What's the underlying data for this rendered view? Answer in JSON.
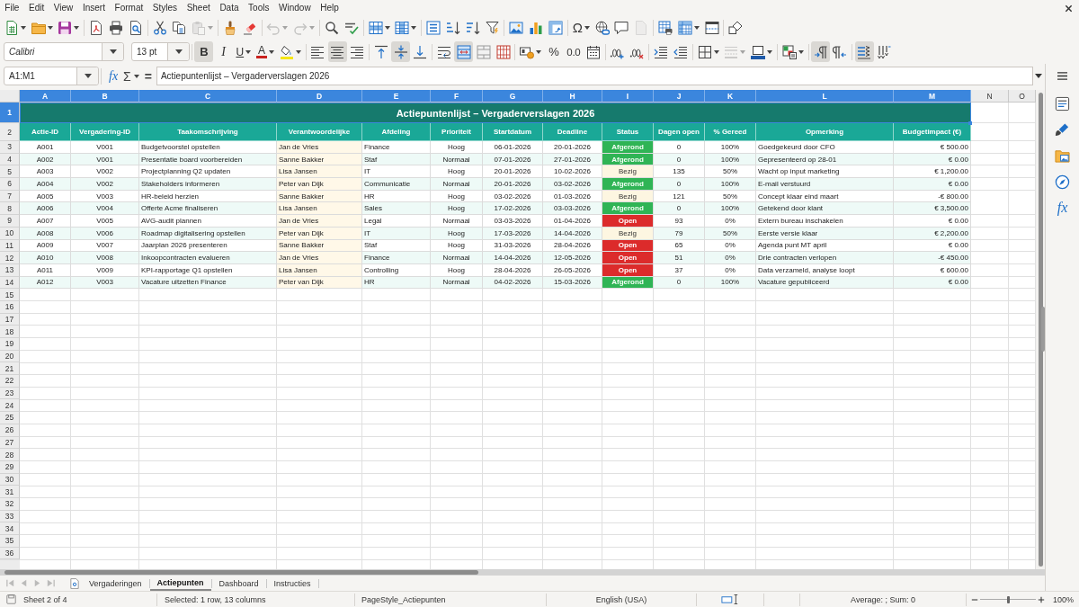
{
  "menu_bar": {
    "items": [
      "File",
      "Edit",
      "View",
      "Insert",
      "Format",
      "Styles",
      "Sheet",
      "Data",
      "Tools",
      "Window",
      "Help"
    ]
  },
  "toolbar_standard": {
    "groups": [
      [
        {
          "kind": "new",
          "dropdown": true,
          "disabled": false
        },
        {
          "kind": "open",
          "dropdown": true,
          "disabled": false
        },
        {
          "kind": "save",
          "dropdown": true,
          "disabled": false
        }
      ],
      [
        {
          "kind": "export_pdf",
          "dropdown": false,
          "disabled": false
        },
        {
          "kind": "print",
          "dropdown": false,
          "disabled": false
        },
        {
          "kind": "print_preview",
          "dropdown": false,
          "disabled": false
        }
      ],
      [
        {
          "kind": "cut",
          "dropdown": false,
          "disabled": false
        },
        {
          "kind": "copy",
          "dropdown": false,
          "disabled": false
        },
        {
          "kind": "paste",
          "dropdown": true,
          "disabled": true
        }
      ],
      [
        {
          "kind": "clone",
          "dropdown": false,
          "disabled": false
        },
        {
          "kind": "clear_format",
          "dropdown": false,
          "disabled": false
        }
      ],
      [
        {
          "kind": "undo",
          "dropdown": true,
          "disabled": true
        },
        {
          "kind": "redo",
          "dropdown": true,
          "disabled": true
        }
      ],
      [
        {
          "kind": "find",
          "dropdown": false,
          "disabled": false
        },
        {
          "kind": "spelling",
          "dropdown": false,
          "disabled": false
        }
      ],
      [
        {
          "kind": "row",
          "dropdown": true,
          "disabled": false
        },
        {
          "kind": "column",
          "dropdown": true,
          "disabled": false
        }
      ],
      [
        {
          "kind": "sort",
          "dropdown": false,
          "disabled": false
        },
        {
          "kind": "sort_asc",
          "dropdown": false,
          "disabled": false
        },
        {
          "kind": "sort_desc",
          "dropdown": false,
          "disabled": false
        },
        {
          "kind": "autofilter",
          "dropdown": false,
          "disabled": false
        }
      ],
      [
        {
          "kind": "image",
          "dropdown": false,
          "disabled": false
        },
        {
          "kind": "chart",
          "dropdown": false,
          "disabled": false
        },
        {
          "kind": "pivot",
          "dropdown": false,
          "disabled": false
        }
      ],
      [
        {
          "kind": "special_char",
          "label": "Ω",
          "dropdown": true,
          "disabled": false
        },
        {
          "kind": "hyperlink",
          "dropdown": false,
          "disabled": false
        },
        {
          "kind": "comment",
          "dropdown": false,
          "disabled": false
        },
        {
          "kind": "header_footer",
          "dropdown": false,
          "disabled": true
        }
      ],
      [
        {
          "kind": "print_area",
          "dropdown": false,
          "disabled": false
        },
        {
          "kind": "freeze",
          "dropdown": true,
          "disabled": false
        },
        {
          "kind": "split",
          "dropdown": false,
          "disabled": false
        }
      ],
      [
        {
          "kind": "shapes",
          "dropdown": false,
          "disabled": false
        }
      ]
    ]
  },
  "toolbar_formatting": {
    "font_name": "Calibri",
    "font_size": "13 pt",
    "groups": [
      [
        {
          "kind": "bold",
          "label": "B",
          "dropdown": false,
          "disabled": false,
          "on": true
        },
        {
          "kind": "italic",
          "label": "I",
          "dropdown": false,
          "disabled": false,
          "on": false
        },
        {
          "kind": "underline",
          "label": "U",
          "dropdown": true,
          "disabled": false,
          "on": false
        },
        {
          "kind": "font_color",
          "label": "A",
          "dropdown": true,
          "disabled": false,
          "on": false
        },
        {
          "kind": "highlight",
          "dropdown": true,
          "disabled": false,
          "on": false
        }
      ],
      [
        {
          "kind": "align_left",
          "dropdown": false,
          "disabled": false,
          "on": false
        },
        {
          "kind": "align_center",
          "dropdown": false,
          "disabled": false,
          "on": true
        },
        {
          "kind": "align_right",
          "dropdown": false,
          "disabled": false,
          "on": false
        }
      ],
      [
        {
          "kind": "align_top",
          "dropdown": false,
          "disabled": false,
          "on": false
        },
        {
          "kind": "align_middle",
          "dropdown": false,
          "disabled": false,
          "on": true
        },
        {
          "kind": "align_bottom",
          "dropdown": false,
          "disabled": false,
          "on": false
        }
      ],
      [
        {
          "kind": "wrap",
          "dropdown": false,
          "disabled": false,
          "on": false
        },
        {
          "kind": "merge_center",
          "dropdown": false,
          "disabled": false,
          "on": true
        },
        {
          "kind": "merge",
          "dropdown": false,
          "disabled": false,
          "on": false
        },
        {
          "kind": "unmerge",
          "dropdown": false,
          "disabled": false,
          "on": false
        }
      ],
      [
        {
          "kind": "currency",
          "dropdown": true,
          "disabled": false,
          "on": false
        },
        {
          "kind": "percent",
          "label": "%",
          "dropdown": false,
          "disabled": false,
          "on": false
        },
        {
          "kind": "standard",
          "label": "0.0",
          "dropdown": false,
          "disabled": false,
          "on": false
        },
        {
          "kind": "date",
          "dropdown": false,
          "disabled": false,
          "on": false
        }
      ],
      [
        {
          "kind": "add_decimal",
          "dropdown": false,
          "disabled": false,
          "on": false
        },
        {
          "kind": "del_decimal",
          "dropdown": false,
          "disabled": false,
          "on": false
        }
      ],
      [
        {
          "kind": "indent_inc",
          "dropdown": false,
          "disabled": false,
          "on": false
        },
        {
          "kind": "indent_dec",
          "dropdown": false,
          "disabled": false,
          "on": false
        }
      ],
      [
        {
          "kind": "borders",
          "dropdown": true,
          "disabled": false,
          "on": false
        },
        {
          "kind": "border_style",
          "dropdown": true,
          "disabled": true,
          "on": false
        },
        {
          "kind": "border_color",
          "dropdown": true,
          "disabled": false,
          "on": false
        }
      ],
      [
        {
          "kind": "conditional",
          "dropdown": true,
          "disabled": false,
          "on": false
        }
      ],
      [
        {
          "kind": "ltr",
          "dropdown": false,
          "disabled": false,
          "on": true
        },
        {
          "kind": "rtl",
          "dropdown": false,
          "disabled": false,
          "on": false
        }
      ],
      [
        {
          "kind": "text_horizontal",
          "dropdown": false,
          "disabled": false,
          "on": true
        },
        {
          "kind": "text_vertical",
          "dropdown": false,
          "disabled": false,
          "on": false
        }
      ]
    ]
  },
  "formula_bar": {
    "name_box": "A1:M1",
    "function_wizard": "fx",
    "sum": "Σ",
    "equals": "=",
    "content": "Actiepuntenlijst – Vergaderverslagen 2026"
  },
  "sidebar": {
    "items": [
      {
        "kind": "properties"
      },
      {
        "kind": "styles"
      },
      {
        "kind": "gallery"
      },
      {
        "kind": "navigator"
      },
      {
        "kind": "functions",
        "label": "fx"
      }
    ]
  },
  "sheet": {
    "column_headers": [
      {
        "label": "A",
        "selected": true
      },
      {
        "label": "B",
        "selected": true
      },
      {
        "label": "C",
        "selected": true
      },
      {
        "label": "D",
        "selected": true
      },
      {
        "label": "E",
        "selected": true
      },
      {
        "label": "F",
        "selected": true
      },
      {
        "label": "G",
        "selected": true
      },
      {
        "label": "H",
        "selected": true
      },
      {
        "label": "I",
        "selected": true
      },
      {
        "label": "J",
        "selected": true
      },
      {
        "label": "K",
        "selected": true
      },
      {
        "label": "L",
        "selected": true
      },
      {
        "label": "M",
        "selected": true
      },
      {
        "label": "N",
        "selected": false
      },
      {
        "label": "O",
        "selected": false
      }
    ],
    "row_headers": [
      {
        "label": "1",
        "selected": true
      },
      {
        "label": "2",
        "selected": false
      },
      {
        "label": "3",
        "selected": false
      },
      {
        "label": "4",
        "selected": false
      },
      {
        "label": "5",
        "selected": false
      },
      {
        "label": "6",
        "selected": false
      },
      {
        "label": "7",
        "selected": false
      },
      {
        "label": "8",
        "selected": false
      },
      {
        "label": "9",
        "selected": false
      },
      {
        "label": "10",
        "selected": false
      },
      {
        "label": "11",
        "selected": false
      },
      {
        "label": "12",
        "selected": false
      },
      {
        "label": "13",
        "selected": false
      },
      {
        "label": "14",
        "selected": false
      },
      {
        "label": "15",
        "selected": false
      },
      {
        "label": "16",
        "selected": false
      },
      {
        "label": "17",
        "selected": false
      },
      {
        "label": "18",
        "selected": false
      },
      {
        "label": "19",
        "selected": false
      },
      {
        "label": "20",
        "selected": false
      },
      {
        "label": "21",
        "selected": false
      },
      {
        "label": "22",
        "selected": false
      },
      {
        "label": "23",
        "selected": false
      },
      {
        "label": "24",
        "selected": false
      },
      {
        "label": "25",
        "selected": false
      },
      {
        "label": "26",
        "selected": false
      },
      {
        "label": "27",
        "selected": false
      },
      {
        "label": "28",
        "selected": false
      },
      {
        "label": "29",
        "selected": false
      },
      {
        "label": "30",
        "selected": false
      },
      {
        "label": "31",
        "selected": false
      },
      {
        "label": "32",
        "selected": false
      },
      {
        "label": "33",
        "selected": false
      },
      {
        "label": "34",
        "selected": false
      },
      {
        "label": "35",
        "selected": false
      },
      {
        "label": "36",
        "selected": false
      }
    ],
    "title": "Actiepuntenlijst – Vergaderverslagen 2026",
    "columns": [
      "Actie-ID",
      "Vergadering-ID",
      "Taakomschrijving",
      "Verantwoordelijke",
      "Afdeling",
      "Prioriteit",
      "Startdatum",
      "Deadline",
      "Status",
      "Dagen open",
      "% Gereed",
      "Opmerking",
      "Budgetimpact (€)"
    ],
    "rows": [
      {
        "kind": "done",
        "cells": [
          "A001",
          "V001",
          "Budgetvoorstel opstellen",
          "Jan de Vries",
          "Finance",
          "Hoog",
          "06-01-2026",
          "20-01-2026",
          "Afgerond",
          "0",
          "100%",
          "Goedgekeurd door CFO",
          "€ 500.00"
        ]
      },
      {
        "kind": "done",
        "cells": [
          "A002",
          "V001",
          "Presentatie board voorbereiden",
          "Sanne Bakker",
          "Staf",
          "Normaal",
          "07-01-2026",
          "27-01-2026",
          "Afgerond",
          "0",
          "100%",
          "Gepresenteerd op 28-01",
          "€ 0.00"
        ]
      },
      {
        "kind": "busy",
        "cells": [
          "A003",
          "V002",
          "Projectplanning Q2 updaten",
          "Lisa Jansen",
          "IT",
          "Hoog",
          "20-01-2026",
          "10-02-2026",
          "Bezig",
          "135",
          "50%",
          "Wacht op input marketing",
          "€ 1,200.00"
        ]
      },
      {
        "kind": "done",
        "cells": [
          "A004",
          "V002",
          "Stakeholders informeren",
          "Peter van Dijk",
          "Communicatie",
          "Normaal",
          "20-01-2026",
          "03-02-2026",
          "Afgerond",
          "0",
          "100%",
          "E-mail verstuurd",
          "€ 0.00"
        ]
      },
      {
        "kind": "busy",
        "cells": [
          "A005",
          "V003",
          "HR-beleid herzien",
          "Sanne Bakker",
          "HR",
          "Hoog",
          "03-02-2026",
          "01-03-2026",
          "Bezig",
          "121",
          "50%",
          "Concept klaar eind maart",
          "-€ 800.00"
        ]
      },
      {
        "kind": "done",
        "cells": [
          "A006",
          "V004",
          "Offerte Acme finaliseren",
          "Lisa Jansen",
          "Sales",
          "Hoog",
          "17-02-2026",
          "03-03-2026",
          "Afgerond",
          "0",
          "100%",
          "Getekend door klant",
          "€ 3,500.00"
        ]
      },
      {
        "kind": "open",
        "cells": [
          "A007",
          "V005",
          "AVG-audit plannen",
          "Jan de Vries",
          "Legal",
          "Normaal",
          "03-03-2026",
          "01-04-2026",
          "Open",
          "93",
          "0%",
          "Extern bureau inschakelen",
          "€ 0.00"
        ]
      },
      {
        "kind": "busy",
        "cells": [
          "A008",
          "V006",
          "Roadmap digitalisering opstellen",
          "Peter van Dijk",
          "IT",
          "Hoog",
          "17-03-2026",
          "14-04-2026",
          "Bezig",
          "79",
          "50%",
          "Eerste versie klaar",
          "€ 2,200.00"
        ]
      },
      {
        "kind": "open",
        "cells": [
          "A009",
          "V007",
          "Jaarplan 2026 presenteren",
          "Sanne Bakker",
          "Staf",
          "Hoog",
          "31-03-2026",
          "28-04-2026",
          "Open",
          "65",
          "0%",
          "Agenda punt MT april",
          "€ 0.00"
        ]
      },
      {
        "kind": "open",
        "cells": [
          "A010",
          "V008",
          "Inkoopcontracten evalueren",
          "Jan de Vries",
          "Finance",
          "Normaal",
          "14-04-2026",
          "12-05-2026",
          "Open",
          "51",
          "0%",
          "Drie contracten verlopen",
          "-€ 450.00"
        ]
      },
      {
        "kind": "open",
        "cells": [
          "A011",
          "V009",
          "KPI-rapportage Q1 opstellen",
          "Lisa Jansen",
          "Controlling",
          "Hoog",
          "28-04-2026",
          "26-05-2026",
          "Open",
          "37",
          "0%",
          "Data verzameld, analyse loopt",
          "€ 600.00"
        ]
      },
      {
        "kind": "done",
        "cells": [
          "A012",
          "V003",
          "Vacature uitzetten Finance",
          "Peter van Dijk",
          "HR",
          "Normaal",
          "04-02-2026",
          "15-03-2026",
          "Afgerond",
          "0",
          "100%",
          "Vacature gepubliceerd",
          "€ 0.00"
        ]
      }
    ]
  },
  "sheet_tabs": {
    "navigation": [
      {
        "kind": "first",
        "disabled": true
      },
      {
        "kind": "previous",
        "disabled": true
      },
      {
        "kind": "next",
        "disabled": true
      },
      {
        "kind": "last",
        "disabled": true
      }
    ],
    "tabs": [
      {
        "label": "Vergaderingen",
        "selected": false
      },
      {
        "label": "Actiepunten",
        "selected": true
      },
      {
        "label": "Dashboard",
        "selected": false
      },
      {
        "label": "Instructies",
        "selected": false
      }
    ]
  },
  "status_bar": {
    "sheet": "Sheet 2 of 4",
    "selection": "Selected: 1 row, 13 columns",
    "page_style": "PageStyle_Actiepunten",
    "language": "English (USA)",
    "summary": "Average: ; Sum: 0",
    "zoom_slider": {
      "level": 0.5
    },
    "zoom": "100%"
  }
}
